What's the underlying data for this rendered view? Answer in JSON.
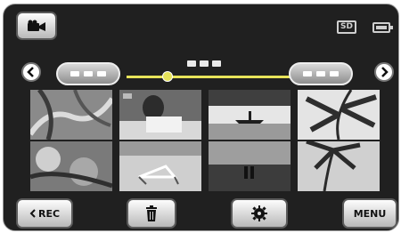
{
  "header": {
    "mode_icon": "video-camera-icon",
    "card_label": "SD",
    "battery_icon": "battery-icon"
  },
  "navigation": {
    "prev_icon": "chevron-left-icon",
    "next_icon": "chevron-right-icon",
    "date_slider_position": 0.25,
    "slider_color": "#e8e35a"
  },
  "thumbnails": [
    {
      "scene": "palm-leaves"
    },
    {
      "scene": "person-reading"
    },
    {
      "scene": "boat-on-lake"
    },
    {
      "scene": "palm-fronds"
    },
    {
      "scene": "tropical-plants"
    },
    {
      "scene": "beach-chair"
    },
    {
      "scene": "couple-on-shore"
    },
    {
      "scene": "palm-tree-sky"
    }
  ],
  "bottom_bar": {
    "rec_label": "REC",
    "trash_icon": "trash-icon",
    "settings_icon": "gear-icon",
    "menu_label": "MENU"
  }
}
